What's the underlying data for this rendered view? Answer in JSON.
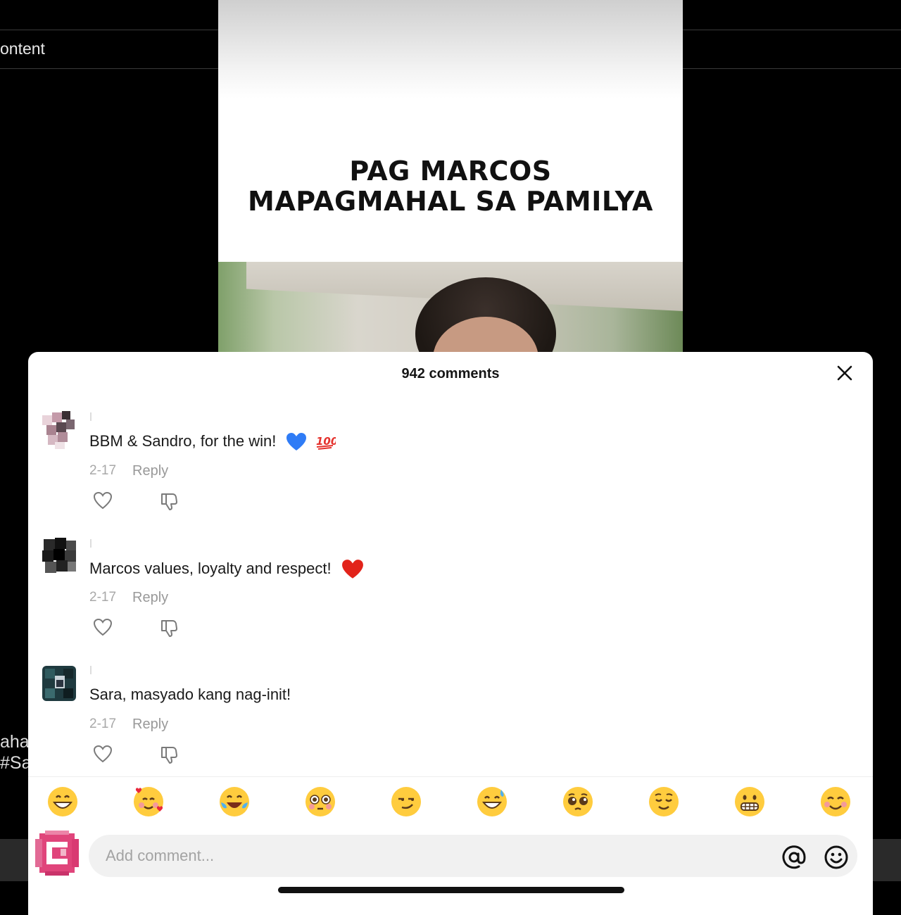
{
  "background": {
    "left_label": "ontent",
    "side_fragments": [
      "aha",
      "#Sa"
    ]
  },
  "video": {
    "caption_line1": "PAG MARCOS",
    "caption_line2": "MAPAGMAHAL SA PAMILYA"
  },
  "comments_panel": {
    "title": "942 comments",
    "comments": [
      {
        "text": "BBM & Sandro, for the win!",
        "emojis": [
          "blue-heart-icon",
          "hundred-points-icon"
        ],
        "date": "2-17",
        "reply_label": "Reply"
      },
      {
        "text": "Marcos values, loyalty and respect!",
        "emojis": [
          "red-heart-icon"
        ],
        "date": "2-17",
        "reply_label": "Reply"
      },
      {
        "text": "Sara, masyado kang nag-init!",
        "emojis": [],
        "date": "2-17",
        "reply_label": "Reply"
      }
    ],
    "quick_emojis": [
      "grinning-face-icon",
      "smiling-face-with-hearts-icon",
      "tears-of-joy-icon",
      "flushed-face-icon",
      "smirking-face-icon",
      "grinning-sweat-icon",
      "pleading-face-icon",
      "relieved-face-icon",
      "grimacing-face-icon",
      "smiling-blush-icon"
    ],
    "input": {
      "placeholder": "Add comment..."
    }
  },
  "colors": {
    "accent_avatar": "#e0457b",
    "sheet_bg": "#ffffff",
    "muted_text": "#a8a8a8"
  }
}
